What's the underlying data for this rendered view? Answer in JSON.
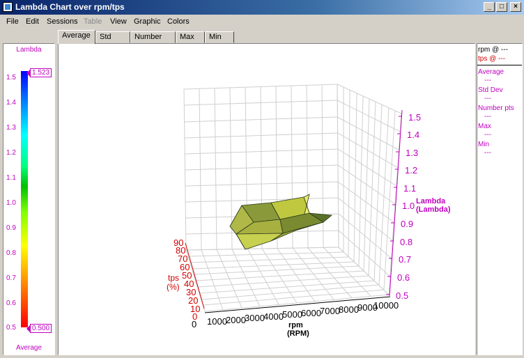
{
  "window": {
    "title": "Lambda Chart over rpm/tps"
  },
  "menu": {
    "file": "File",
    "edit": "Edit",
    "sessions": "Sessions",
    "table": "Table",
    "view": "View",
    "graphic": "Graphic",
    "colors": "Colors"
  },
  "tabs": [
    "Average",
    "Std Dev",
    "Number pts",
    "Max",
    "Min"
  ],
  "legend": {
    "title": "Lambda",
    "footer": "Average",
    "ticks": [
      "1.5",
      "1.4",
      "1.3",
      "1.2",
      "1.1",
      "1.0",
      "0.9",
      "0.8",
      "0.7",
      "0.6",
      "0.5"
    ],
    "max_flag": "1.523",
    "min_flag": "0.500"
  },
  "chart": {
    "z_ticks": [
      "1.5",
      "1.4",
      "1.3",
      "1.2",
      "1.1",
      "1.0",
      "0.9",
      "0.8",
      "0.7",
      "0.6",
      "0.5"
    ],
    "z_label_1": "Lambda",
    "z_label_2": "(Lambda)",
    "y_ticks": [
      "90",
      "80",
      "70",
      "60",
      "50",
      "40",
      "30",
      "20",
      "10",
      "0"
    ],
    "y_label_1": "tps",
    "y_label_2": "(%)",
    "x_ticks": [
      "0",
      "1000",
      "2000",
      "3000",
      "4000",
      "5000",
      "6000",
      "7000",
      "8000",
      "9000",
      "10000"
    ],
    "x_label_1": "rpm",
    "x_label_2": "(RPM)"
  },
  "info": {
    "rpm_at": "rpm @ ---",
    "tps_at": "tps @ ---",
    "average_label": "Average",
    "average_value": "---",
    "stddev_label": "Std Dev",
    "stddev_value": "---",
    "numpts_label": "Number pts",
    "numpts_value": "---",
    "max_label": "Max",
    "max_value": "---",
    "min_label": "Min",
    "min_value": "---"
  }
}
